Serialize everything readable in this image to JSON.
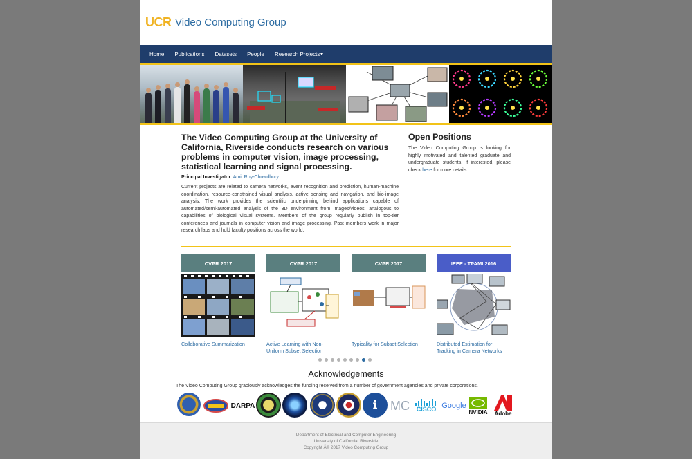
{
  "header": {
    "logo_text": "UCR",
    "site_title": "Video Computing Group"
  },
  "nav": {
    "items": [
      "Home",
      "Publications",
      "Datasets",
      "People"
    ],
    "dropdown_label": "Research Projects"
  },
  "intro": {
    "title": "The Video Computing Group at the University of California, Riverside conducts research on various problems in computer vision, image processing, statistical learning and signal processing.",
    "pi_label": "Principal Investigator",
    "pi_name": "Amit Roy-Chowdhury",
    "body": "Current projects are related to camera networks, event recognition and prediction, human-machine coordination, resource-constrained visual analysis, active sensing and navigation, and bio-image analysis. The work provides the scientific underpinning behind applications capable of automated/semi-automated analysis of the 3D environment from images/videos, analogous to capabilities of biological visual systems. Members of the group regularly publish in top-tier conferences and journals in computer vision and image processing. Past members work in major research labs and hold faculty positions across the world."
  },
  "positions": {
    "title": "Open Positions",
    "body_before": "The Video Computing Group is looking for highly motivated and talented graduate and undergraduate students. If interested, please check ",
    "link_text": "here",
    "body_after": " for more details."
  },
  "cards": [
    {
      "venue": "CVPR 2017",
      "title": "Collaborative Summarization",
      "color": "#5a7f7f"
    },
    {
      "venue": "CVPR 2017",
      "title": "Active Learning with Non-Uniform Subset Selection",
      "color": "#5a7f7f"
    },
    {
      "venue": "CVPR 2017",
      "title": "Typicality for Subset Selection",
      "color": "#5a7f7f"
    },
    {
      "venue": "IEEE - TPAMI 2016",
      "title": "Distributed Estimation for Tracking in Camera Networks",
      "color": "#4a5dc8"
    }
  ],
  "carousel": {
    "total": 9,
    "active_index": 7
  },
  "ack": {
    "title": "Acknowledgements",
    "text": "The Video Computing Group graciously acknowledges the funding received from a number of government agencies and private corporations.",
    "logos": [
      "nsf",
      "onr",
      "darpa",
      "seal-green",
      "nasa-seal",
      "navy-seal",
      "dod-seal",
      "iarpa",
      "mc",
      "cisco",
      "google",
      "nvidia",
      "adobe"
    ],
    "logo_labels": {
      "darpa": "DARPA",
      "mc": "MC",
      "cisco": "CISCO",
      "google": "Google",
      "nvidia": "NVIDIA",
      "adobe": "Adobe"
    }
  },
  "footer": {
    "line1": "Department of Electrical and Computer Engineering",
    "line2": "University of California, Riverside",
    "line3": "Copyright Â© 2017 Video Computing Group"
  },
  "colors": {
    "nav_bg": "#1f3d6b",
    "accent_gold": "#f2c318",
    "link_blue": "#2d6ca2",
    "card_teal": "#5a7f7f",
    "card_blue": "#4a5dc8"
  }
}
